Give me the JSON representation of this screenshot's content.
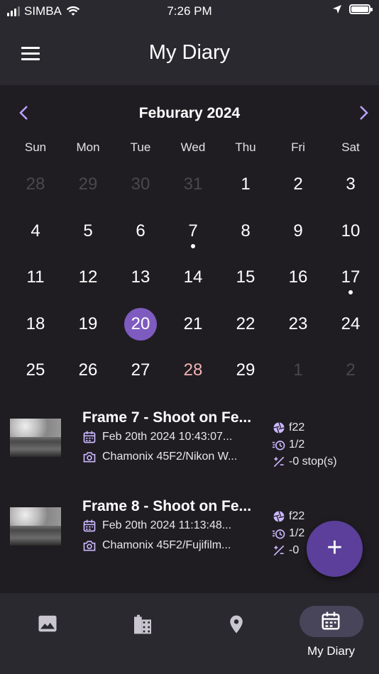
{
  "status": {
    "carrier": "SIMBA",
    "time": "7:26 PM"
  },
  "header": {
    "title": "My Diary"
  },
  "calendar": {
    "month_label": "Feburary 2024",
    "weekdays": [
      "Sun",
      "Mon",
      "Tue",
      "Wed",
      "Thu",
      "Fri",
      "Sat"
    ],
    "weeks": [
      [
        {
          "d": "28",
          "o": true
        },
        {
          "d": "29",
          "o": true
        },
        {
          "d": "30",
          "o": true
        },
        {
          "d": "31",
          "o": true
        },
        {
          "d": "1"
        },
        {
          "d": "2"
        },
        {
          "d": "3"
        }
      ],
      [
        {
          "d": "4"
        },
        {
          "d": "5"
        },
        {
          "d": "6"
        },
        {
          "d": "7",
          "dot": true
        },
        {
          "d": "8"
        },
        {
          "d": "9"
        },
        {
          "d": "10"
        }
      ],
      [
        {
          "d": "11"
        },
        {
          "d": "12"
        },
        {
          "d": "13"
        },
        {
          "d": "14"
        },
        {
          "d": "15"
        },
        {
          "d": "16"
        },
        {
          "d": "17",
          "dot": true
        }
      ],
      [
        {
          "d": "18"
        },
        {
          "d": "19"
        },
        {
          "d": "20",
          "sel": true
        },
        {
          "d": "21"
        },
        {
          "d": "22"
        },
        {
          "d": "23"
        },
        {
          "d": "24"
        }
      ],
      [
        {
          "d": "25"
        },
        {
          "d": "26"
        },
        {
          "d": "27"
        },
        {
          "d": "28",
          "hl": true
        },
        {
          "d": "29"
        },
        {
          "d": "1",
          "o": true
        },
        {
          "d": "2",
          "o": true
        }
      ]
    ],
    "accent_color": "#7e5bbf"
  },
  "entries": [
    {
      "title": "Frame 7 - Shoot on Fe...",
      "date": "Feb 20th 2024 10:43:07...",
      "camera": "Chamonix 45F2/Nikon W...",
      "aperture": "f22",
      "shutter": "1/2",
      "exposure": "-0 stop(s)"
    },
    {
      "title": "Frame 8 - Shoot on Fe...",
      "date": "Feb 20th 2024 11:13:48...",
      "camera": "Chamonix 45F2/Fujifilm...",
      "aperture": "f22",
      "shutter": "1/2",
      "exposure": "-0"
    }
  ],
  "fab": {
    "label": "+"
  },
  "bottom_nav": {
    "items": [
      {
        "icon": "image-icon",
        "label": ""
      },
      {
        "icon": "film-icon",
        "label": ""
      },
      {
        "icon": "location-pin-icon",
        "label": ""
      },
      {
        "icon": "calendar-icon",
        "label": "My Diary",
        "active": true
      }
    ]
  }
}
